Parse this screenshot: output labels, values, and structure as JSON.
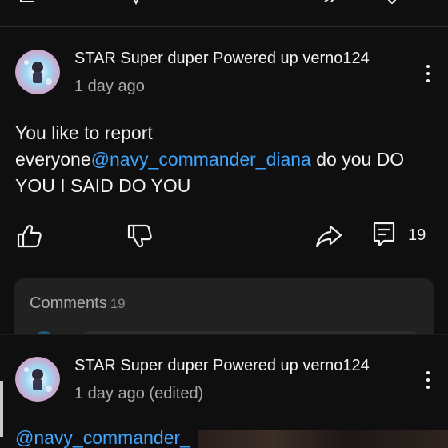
{
  "colors": {
    "background": "#0f0f0f",
    "mention": "#3ea6ff",
    "secondary_text": "#aaaaaa",
    "panel": "#212121"
  },
  "top_toolbar": {
    "icons": [
      "menu-icon",
      "dislike-icon",
      "share-icon",
      "reply-icon"
    ]
  },
  "comment": {
    "author": "STAR Super duper Powered up verno124",
    "time": "1 day ago",
    "text_before": "You like to report everyone",
    "mention": "@navy_commander_diana",
    "text_after": " do you DO YOU I SAID DO YOU",
    "reply_count": "19",
    "icons": [
      "like-icon",
      "dislike-icon",
      "share-icon",
      "reply-icon"
    ]
  },
  "comments_panel": {
    "label": "Comments",
    "count": "19"
  },
  "reply": {
    "author": "STAR Super duper Powered up verno124",
    "time": "1 day ago (edited)",
    "mention_partial": "@navy_commander_"
  }
}
